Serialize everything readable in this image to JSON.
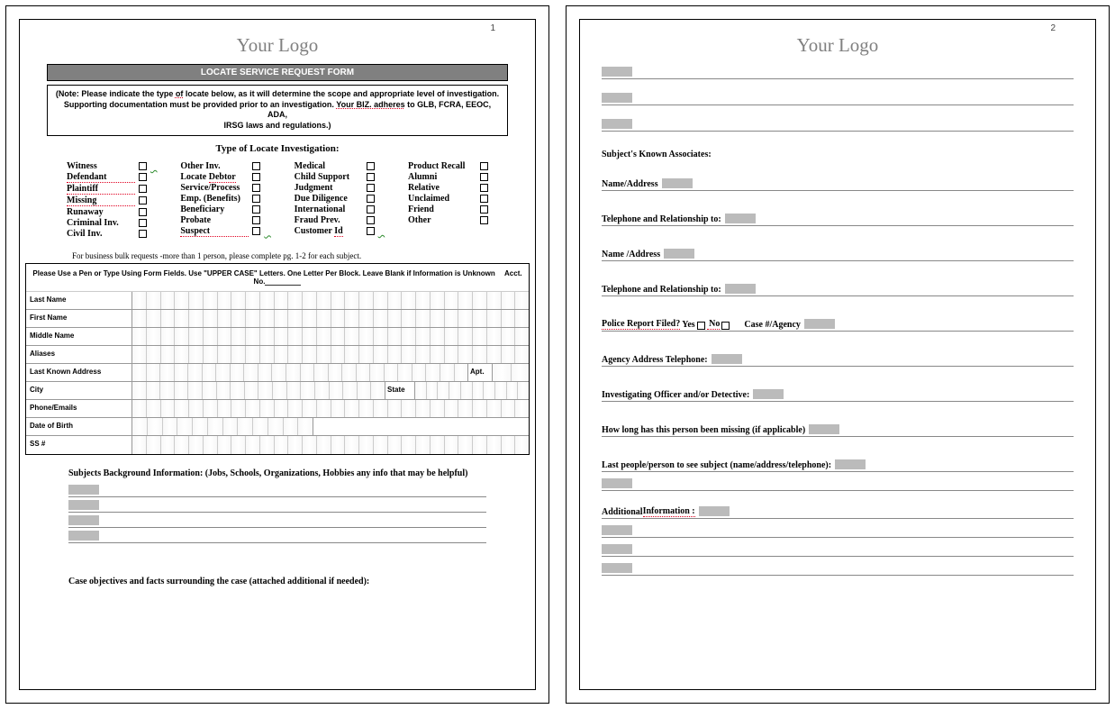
{
  "pages": {
    "p1": {
      "num": "1"
    },
    "p2": {
      "num": "2"
    }
  },
  "logo": "Your Logo",
  "title": "LOCATE SERVICE REQUEST FORM",
  "note": {
    "line1a": "(Note: Please indicate the type ",
    "line1b": "of",
    "line1c": " locate below, as it will determine the scope and appropriate level of investigation.",
    "line2a": "Supporting documentation must be provided prior to an investigation. ",
    "line2b": "Your BIZ. adheres",
    "line2c": " to GLB, FCRA, EEOC, ADA,",
    "line3": "IRSG laws and regulations.)"
  },
  "type_heading": "Type of Locate Investigation:",
  "types": {
    "col1": [
      "Witness",
      "Defendant",
      "Plaintiff",
      "Missing",
      "Runaway",
      "Criminal Inv.",
      "Civil Inv."
    ],
    "col2": [
      "Other Inv.",
      "Locate Debtor",
      "Service/Process",
      "Emp. (Benefits)",
      "Beneficiary",
      "Probate",
      "Suspect"
    ],
    "col3": [
      "Medical",
      "Child Support",
      "Judgment",
      "Due Diligence",
      "International",
      "Fraud Prev.",
      "Customer Id"
    ],
    "col4": [
      "Product Recall",
      "Alumni",
      "Relative",
      "Unclaimed",
      "Friend",
      "Other"
    ]
  },
  "bulk_note": "For business bulk requests -more than 1 person, please complete pg. 1-2 for each subject.",
  "instr": "Please Use a Pen or Type Using Form Fields.  Use \"UPPER CASE\" Letters. One Letter Per Block.  Leave Blank if Information is Unknown",
  "acct": "Acct. No.",
  "fields": {
    "last": "Last Name",
    "first": "First Name",
    "middle": "Middle Name",
    "aliases": "Aliases",
    "addr": "Last Known Address",
    "apt": "Apt.",
    "city": "City",
    "state": "State",
    "phone": "Phone/Emails",
    "dob": "Date of Birth",
    "ssn": "SS #"
  },
  "bg_info": "Subjects Background Information: (Jobs, Schools, Organizations, Hobbies any info that may be helpful)",
  "case_obj": "Case objectives and facts surrounding the case (attached additional if needed):",
  "p2": {
    "assoc_heading": "Subject's Known Associates:",
    "name_addr": "Name/Address",
    "tel_rel": "Telephone and Relationship to:",
    "name_addr2": "Name /Address",
    "police_a": "Police Report Filed?",
    "yes": "Yes",
    "no": "No",
    "case_agency": "Case #/Agency",
    "agency_addr": "Agency Address Telephone:",
    "officer": "Investigating Officer and/or Detective:",
    "missing": "How long has this person been missing (if applicable)",
    "last_seen": "Last people/person to see subject (name/address/telephone):",
    "addl_a": "Additional ",
    "addl_b": "Information :"
  }
}
